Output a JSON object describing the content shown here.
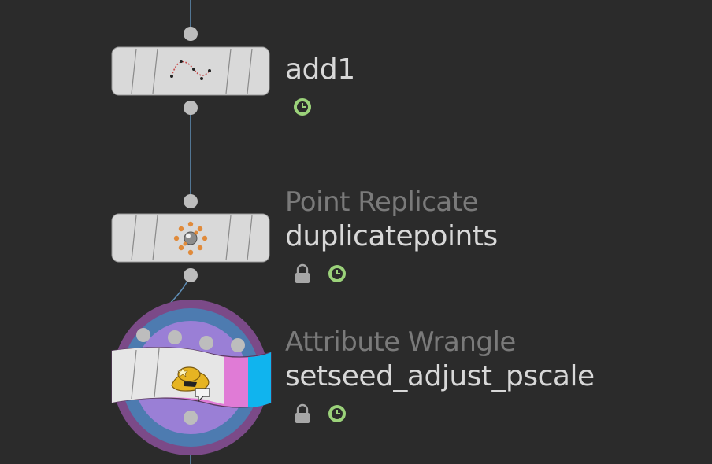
{
  "colors": {
    "background": "#2b2b2b",
    "node_body": "#d9d9d9",
    "wire": "#5f8fb8",
    "connector": "#bdbdbd",
    "time_dependent_badge": "#9bd27a",
    "lock_badge": "#a7a7a7",
    "ring_outer": "#7b4a88",
    "ring_mid": "#4d7bb0",
    "ring_inner": "#9a7fd6",
    "wrangle_pink": "#e07bd6",
    "wrangle_cyan": "#10b4ee"
  },
  "nodes": [
    {
      "id": "add1",
      "type_label": "",
      "name": "add1",
      "icon": "curve-points-icon",
      "flags": [
        "time-dependent-icon"
      ]
    },
    {
      "id": "duplicatepoints",
      "type_label": "Point Replicate",
      "name": "duplicatepoints",
      "icon": "point-replicate-icon",
      "flags": [
        "lock-icon",
        "time-dependent-icon"
      ]
    },
    {
      "id": "setseed_adjust_pscale",
      "type_label": "Attribute Wrangle",
      "name": "setseed_adjust_pscale",
      "icon": "cowboy-hat-icon",
      "flags": [
        "lock-icon",
        "time-dependent-icon"
      ],
      "display_flag_on": true
    }
  ]
}
